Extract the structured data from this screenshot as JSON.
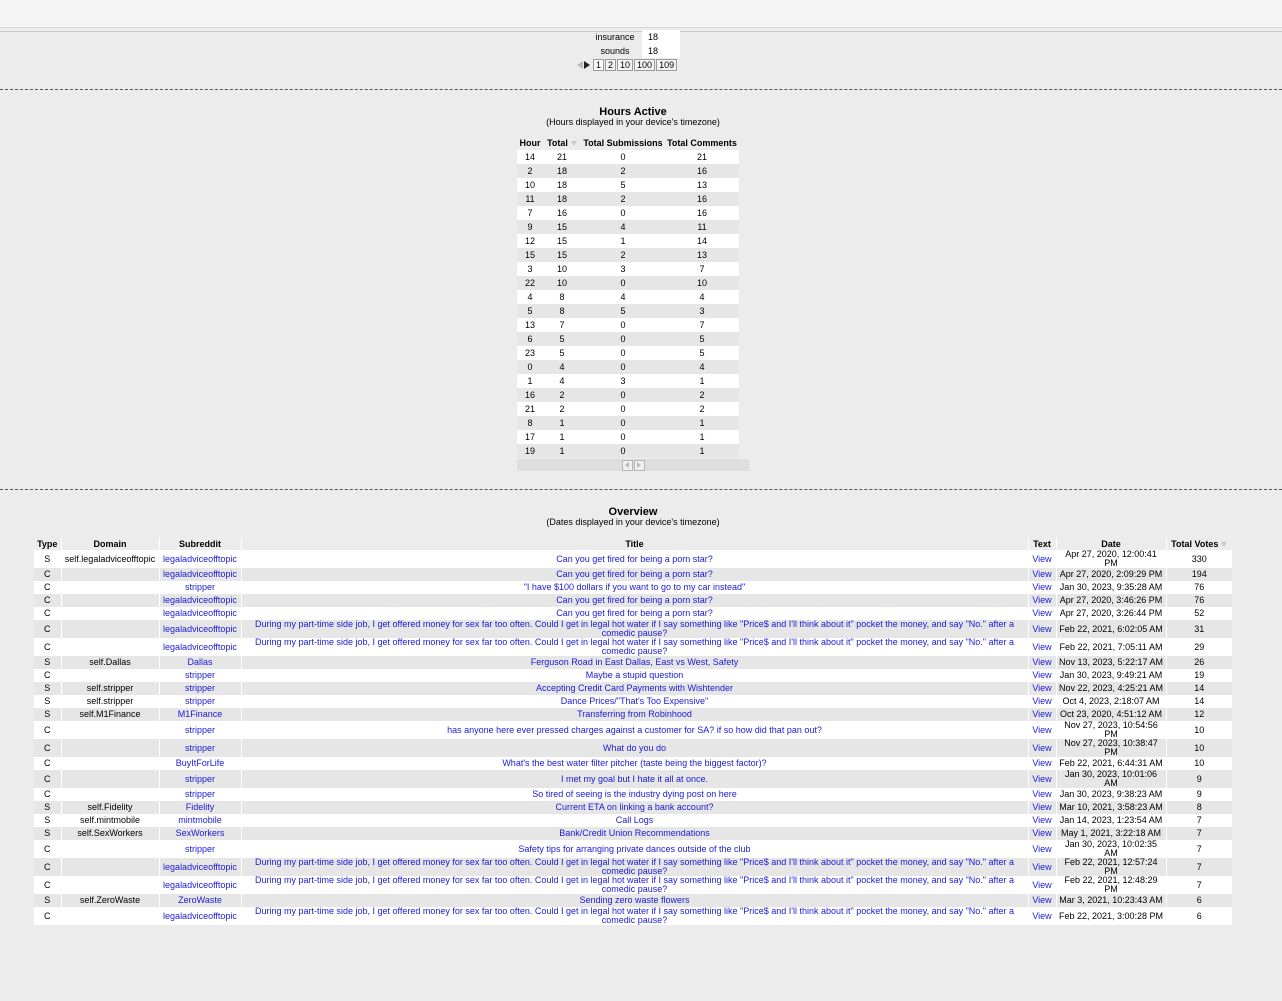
{
  "word_table": [
    {
      "word": "insurance",
      "count": "18"
    },
    {
      "word": "sounds",
      "count": "18"
    }
  ],
  "word_pager": {
    "pages": [
      "1",
      "2",
      "10",
      "100",
      "109"
    ],
    "current": "1"
  },
  "hours": {
    "title": "Hours Active",
    "subtitle": "(Hours displayed in your device's timezone)",
    "headers": [
      "Hour",
      "Total",
      "Total Submissions",
      "Total Comments"
    ],
    "rows": [
      [
        "14",
        "21",
        "0",
        "21"
      ],
      [
        "2",
        "18",
        "2",
        "16"
      ],
      [
        "10",
        "18",
        "5",
        "13"
      ],
      [
        "11",
        "18",
        "2",
        "16"
      ],
      [
        "7",
        "16",
        "0",
        "16"
      ],
      [
        "9",
        "15",
        "4",
        "11"
      ],
      [
        "12",
        "15",
        "1",
        "14"
      ],
      [
        "15",
        "15",
        "2",
        "13"
      ],
      [
        "3",
        "10",
        "3",
        "7"
      ],
      [
        "22",
        "10",
        "0",
        "10"
      ],
      [
        "4",
        "8",
        "4",
        "4"
      ],
      [
        "5",
        "8",
        "5",
        "3"
      ],
      [
        "13",
        "7",
        "0",
        "7"
      ],
      [
        "6",
        "5",
        "0",
        "5"
      ],
      [
        "23",
        "5",
        "0",
        "5"
      ],
      [
        "0",
        "4",
        "0",
        "4"
      ],
      [
        "1",
        "4",
        "3",
        "1"
      ],
      [
        "16",
        "2",
        "0",
        "2"
      ],
      [
        "21",
        "2",
        "0",
        "2"
      ],
      [
        "8",
        "1",
        "0",
        "1"
      ],
      [
        "17",
        "1",
        "0",
        "1"
      ],
      [
        "19",
        "1",
        "0",
        "1"
      ]
    ]
  },
  "overview": {
    "title": "Overview",
    "subtitle": "(Dates displayed in your device's timezone)",
    "headers": [
      "Type",
      "Domain",
      "Subreddit",
      "Title",
      "Text",
      "Date",
      "Total Votes"
    ],
    "rows": [
      [
        "S",
        "self.legaladviceofftopic",
        "legaladviceofftopic",
        "Can you get fired for being a porn star?",
        "View",
        "Apr 27, 2020, 12:00:41 PM",
        "330"
      ],
      [
        "C",
        "",
        "legaladviceofftopic",
        "Can you get fired for being a porn star?",
        "View",
        "Apr 27, 2020, 2:09:29 PM",
        "194"
      ],
      [
        "C",
        "",
        "stripper",
        "\"I have $100 dollars if you want to go to my car instead\"",
        "View",
        "Jan 30, 2023, 9:35:28 AM",
        "76"
      ],
      [
        "C",
        "",
        "legaladviceofftopic",
        "Can you get fired for being a porn star?",
        "View",
        "Apr 27, 2020, 3:46:26 PM",
        "76"
      ],
      [
        "C",
        "",
        "legaladviceofftopic",
        "Can you get fired for being a porn star?",
        "View",
        "Apr 27, 2020, 3:26:44 PM",
        "52"
      ],
      [
        "C",
        "",
        "legaladviceofftopic",
        "During my part-time side job, I get offered money for sex far too often. Could I get in legal hot water if I say something like \"Price$ and I'll think about it\" pocket the money, and say \"No.\" after a comedic pause?",
        "View",
        "Feb 22, 2021, 6:02:05 AM",
        "31"
      ],
      [
        "C",
        "",
        "legaladviceofftopic",
        "During my part-time side job, I get offered money for sex far too often. Could I get in legal hot water if I say something like \"Price$ and I'll think about it\" pocket the money, and say \"No.\" after a comedic pause?",
        "View",
        "Feb 22, 2021, 7:05:11 AM",
        "29"
      ],
      [
        "S",
        "self.Dallas",
        "Dallas",
        "Ferguson Road in East Dallas, East vs West, Safety",
        "View",
        "Nov 13, 2023, 5:22:17 AM",
        "26"
      ],
      [
        "C",
        "",
        "stripper",
        "Maybe a stupid question",
        "View",
        "Jan 30, 2023, 9:49:21 AM",
        "19"
      ],
      [
        "S",
        "self.stripper",
        "stripper",
        "Accepting Credit Card Payments with Wishtender",
        "View",
        "Nov 22, 2023, 4:25:21 AM",
        "14"
      ],
      [
        "S",
        "self.stripper",
        "stripper",
        "Dance Prices/\"That's Too Expensive\"",
        "View",
        "Oct 4, 2023, 2:18:07 AM",
        "14"
      ],
      [
        "S",
        "self.M1Finance",
        "M1Finance",
        "Transferring from Robinhood",
        "View",
        "Oct 23, 2020, 4:51:12 AM",
        "12"
      ],
      [
        "C",
        "",
        "stripper",
        "has anyone here ever pressed charges against a customer for SA? if so how did that pan out?",
        "View",
        "Nov 27, 2023, 10:54:56 PM",
        "10"
      ],
      [
        "C",
        "",
        "stripper",
        "What do you do",
        "View",
        "Nov 27, 2023, 10:38:47 PM",
        "10"
      ],
      [
        "C",
        "",
        "BuyItForLife",
        "What's the best water filter pitcher (taste being the biggest factor)?",
        "View",
        "Feb 22, 2021, 6:44:31 AM",
        "10"
      ],
      [
        "C",
        "",
        "stripper",
        "I met my goal but I hate it all at once.",
        "View",
        "Jan 30, 2023, 10:01:06 AM",
        "9"
      ],
      [
        "C",
        "",
        "stripper",
        "So tired of seeing is the industry dying post on here",
        "View",
        "Jan 30, 2023, 9:38:23 AM",
        "9"
      ],
      [
        "S",
        "self.Fidelity",
        "Fidelity",
        "Current ETA on linking a bank account?",
        "View",
        "Mar 10, 2021, 3:58:23 AM",
        "8"
      ],
      [
        "S",
        "self.mintmobile",
        "mintmobile",
        "Call Logs",
        "View",
        "Jan 14, 2023, 1:23:54 AM",
        "7"
      ],
      [
        "S",
        "self.SexWorkers",
        "SexWorkers",
        "Bank/Credit Union Recommendations",
        "View",
        "May 1, 2021, 3:22:18 AM",
        "7"
      ],
      [
        "C",
        "",
        "stripper",
        "Safety tips for arranging private dances outside of the club",
        "View",
        "Jan 30, 2023, 10:02:35 AM",
        "7"
      ],
      [
        "C",
        "",
        "legaladviceofftopic",
        "During my part-time side job, I get offered money for sex far too often. Could I get in legal hot water if I say something like \"Price$ and I'll think about it\" pocket the money, and say \"No.\" after a comedic pause?",
        "View",
        "Feb 22, 2021, 12:57:24 PM",
        "7"
      ],
      [
        "C",
        "",
        "legaladviceofftopic",
        "During my part-time side job, I get offered money for sex far too often. Could I get in legal hot water if I say something like \"Price$ and I'll think about it\" pocket the money, and say \"No.\" after a comedic pause?",
        "View",
        "Feb 22, 2021, 12:48:29 PM",
        "7"
      ],
      [
        "S",
        "self.ZeroWaste",
        "ZeroWaste",
        "Sending zero waste flowers",
        "View",
        "Mar 3, 2021, 10:23:43 AM",
        "6"
      ],
      [
        "C",
        "",
        "legaladviceofftopic",
        "During my part-time side job, I get offered money for sex far too often. Could I get in legal hot water if I say something like \"Price$ and I'll think about it\" pocket the money, and say \"No.\" after a comedic pause?",
        "View",
        "Feb 22, 2021, 3:00:28 PM",
        "6"
      ]
    ]
  }
}
